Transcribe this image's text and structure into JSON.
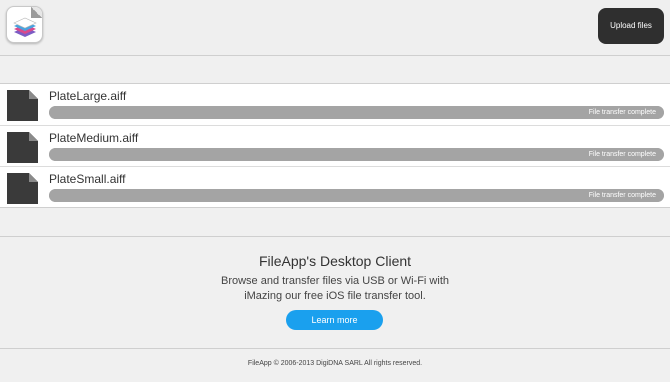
{
  "header": {
    "upload_label": "Upload files"
  },
  "files": [
    {
      "name": "PlateLarge.aiff",
      "progress": 1.0,
      "status": "File transfer complete"
    },
    {
      "name": "PlateMedium.aiff",
      "progress": 1.0,
      "status": "File transfer complete"
    },
    {
      "name": "PlateSmall.aiff",
      "progress": 1.0,
      "status": "File transfer complete"
    }
  ],
  "promo": {
    "title": "FileApp's Desktop Client",
    "line1": "Browse and transfer files via USB or Wi-Fi with",
    "line2": "iMazing our free iOS file transfer tool.",
    "button_label": "Learn more"
  },
  "footer": {
    "copyright": "FileApp © 2006-2013 DigiDNA SARL All rights reserved."
  },
  "colors": {
    "button_dark": "#2f2f2f",
    "accent_blue": "#1aa0ee",
    "progress_gray": "#a4a4a4"
  }
}
